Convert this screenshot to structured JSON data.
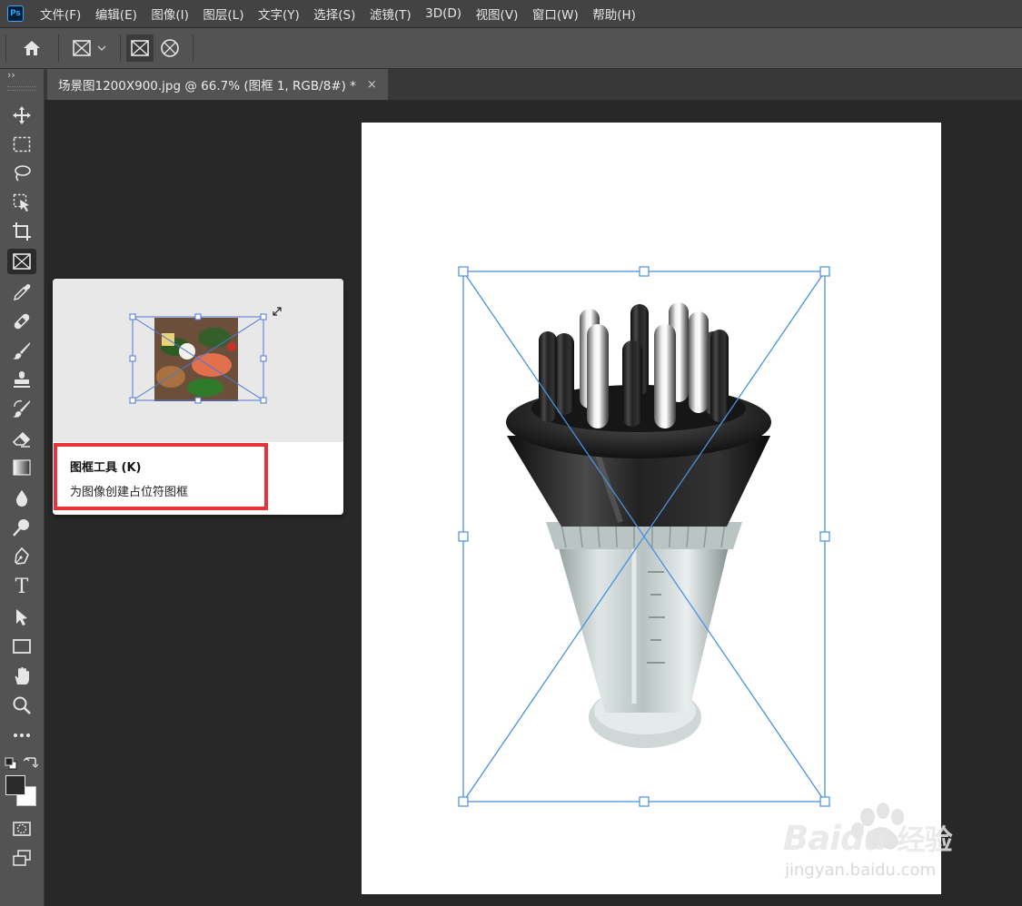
{
  "app": {
    "logo_text": "Ps"
  },
  "menu": [
    "文件(F)",
    "编辑(E)",
    "图像(I)",
    "图层(L)",
    "文字(Y)",
    "选择(S)",
    "滤镜(T)",
    "3D(D)",
    "视图(V)",
    "窗口(W)",
    "帮助(H)"
  ],
  "toolbar_collapse": "››",
  "document_tab": {
    "title": "场景图1200X900.jpg @ 66.7% (图框 1, RGB/8#) *",
    "close": "×"
  },
  "tooltip": {
    "title": "图框工具 (K)",
    "description": "为图像创建占位符图框"
  },
  "type_tool_glyph": "T",
  "watermark": {
    "brand": "Bai",
    "brand2": "du",
    "product": "经验",
    "url": "jingyan.baidu.com"
  },
  "colors": {
    "frame_blue": "#4a90e2",
    "highlight_red": "#e8323a",
    "foreground_swatch": "#2a2a2a",
    "background_swatch": "#ffffff"
  }
}
